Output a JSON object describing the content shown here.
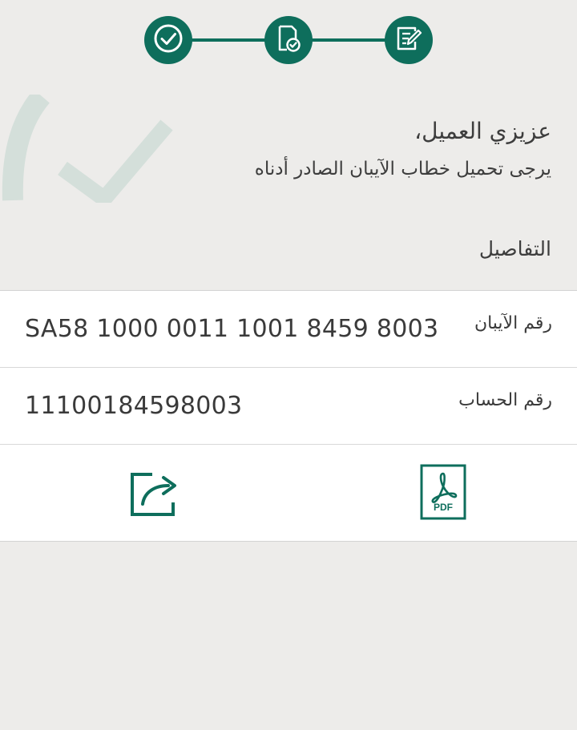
{
  "stepper": {
    "steps": [
      {
        "icon": "check-circle-icon",
        "state": "done"
      },
      {
        "icon": "document-check-icon",
        "state": "done"
      },
      {
        "icon": "edit-form-icon",
        "state": "done"
      }
    ],
    "color": "#0e6e5c"
  },
  "watermark": {
    "icon": "checkmark-watermark-icon",
    "color": "#d4dfda"
  },
  "greeting": {
    "title": "عزيزي العميل،",
    "subtitle": "يرجى تحميل خطاب الآيبان الصادر أدناه"
  },
  "details": {
    "heading": "التفاصيل",
    "rows": [
      {
        "label": "رقم الآيبان",
        "value": "SA58 1000 0011 1001 8459 8003"
      },
      {
        "label": "رقم الحساب",
        "value": "11100184598003"
      }
    ]
  },
  "actions": {
    "share_icon": "share-icon",
    "pdf_icon": "pdf-icon",
    "pdf_text": "PDF"
  },
  "colors": {
    "background": "#edecea",
    "card": "#ffffff",
    "accent": "#0e6e5c"
  }
}
